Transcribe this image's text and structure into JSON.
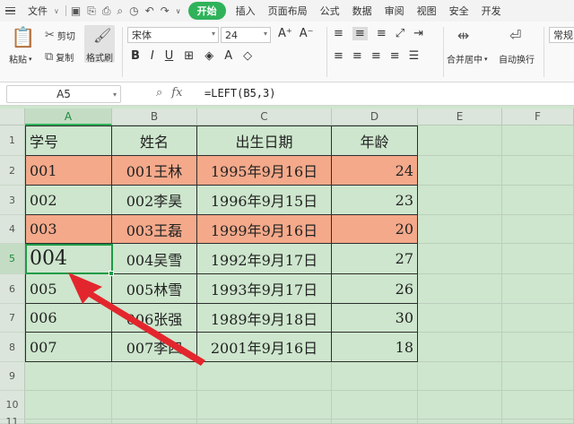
{
  "menu": {
    "file": "文件",
    "tabs": [
      "开始",
      "插入",
      "页面布局",
      "公式",
      "数据",
      "审阅",
      "视图",
      "安全",
      "开发"
    ]
  },
  "ribbon": {
    "paste": "粘贴",
    "cut": "剪切",
    "copy": "复制",
    "format_painter": "格式刷",
    "font_name": "宋体",
    "font_size": "24",
    "merge_center": "合并居中",
    "wrap_text": "自动换行",
    "number_format": "常规"
  },
  "formula_bar": {
    "cell_ref": "A5",
    "fx": "fx",
    "formula": "=LEFT(B5,3)"
  },
  "grid": {
    "columns": [
      "A",
      "B",
      "C",
      "D",
      "E",
      "F"
    ],
    "rows": [
      "1",
      "2",
      "3",
      "4",
      "5",
      "6",
      "7",
      "8",
      "9",
      "10",
      "11"
    ],
    "table": {
      "headers": [
        "学号",
        "姓名",
        "出生日期",
        "年龄"
      ],
      "data": [
        [
          "001",
          "001王林",
          "1995年9月16日",
          "24"
        ],
        [
          "002",
          "002李昊",
          "1996年9月15日",
          "23"
        ],
        [
          "003",
          "003王磊",
          "1999年9月16日",
          "20"
        ],
        [
          "004",
          "004吴雪",
          "1992年9月17日",
          "27"
        ],
        [
          "005",
          "005林雪",
          "1993年9月17日",
          "26"
        ],
        [
          "006",
          "006张强",
          "1989年9月18日",
          "30"
        ],
        [
          "007",
          "007李四",
          "2001年9月16日",
          "18"
        ]
      ]
    },
    "highlight_color": "#f4a98a",
    "selection_color": "#1f9a47"
  },
  "colors": {
    "background": "#cde6cd",
    "accent": "#2fb25a",
    "annotation_arrow": "#e3262d"
  }
}
